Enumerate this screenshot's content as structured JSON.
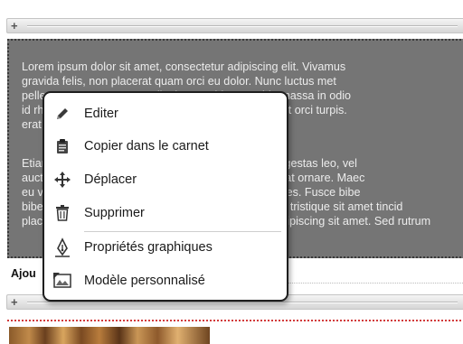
{
  "text_block": {
    "paragraph1": [
      "Lorem ipsum dolor sit amet, consectetur adipiscing elit. Vivamus",
      "gravida felis, non placerat quam orci eu dolor. Nunc luctus met",
      "pellentesque at, cursus ac ligula. Curabitur gravida massa in odio",
      "id rhoncus ipsum. Integer eleifend. Phasellus sit amet orci turpis.",
      "erat"
    ],
    "paragraph2": [
      "Etiam et libero. Morbi aliquam ornare diam, mi nisi egestas leo, vel",
      "auctor tortor nisl eget lorem. Vestibulum vulputate erat ornare. Maec",
      "eu velit. Mauris quis urna volutpat sem volutpat ultrices. Fusce bibe",
      "bibendum. Sed tincidunt, quam ut pulvinar vulputate, tristique sit amet tincid",
      "placerat. Lorem ipsum dolor sit amet, consectetur adipiscing sit amet. Sed rutrum"
    ]
  },
  "block_label": "Ajou",
  "context_menu": {
    "items": [
      {
        "label": "Editer",
        "icon": "pencil-icon"
      },
      {
        "label": "Copier dans le carnet",
        "icon": "clipboard-icon"
      },
      {
        "label": "Déplacer",
        "icon": "move-arrows-icon"
      },
      {
        "label": "Supprimer",
        "icon": "trash-icon"
      },
      {
        "label": "Propriétés graphiques",
        "icon": "pen-nib-icon"
      },
      {
        "label": "Modèle personnalisé",
        "icon": "template-icon"
      }
    ]
  },
  "colors": {
    "text_block_bg": "#757575",
    "text_block_text": "#ececec",
    "menu_border": "#1e1e1e",
    "image_block_border": "#d23a3a"
  }
}
